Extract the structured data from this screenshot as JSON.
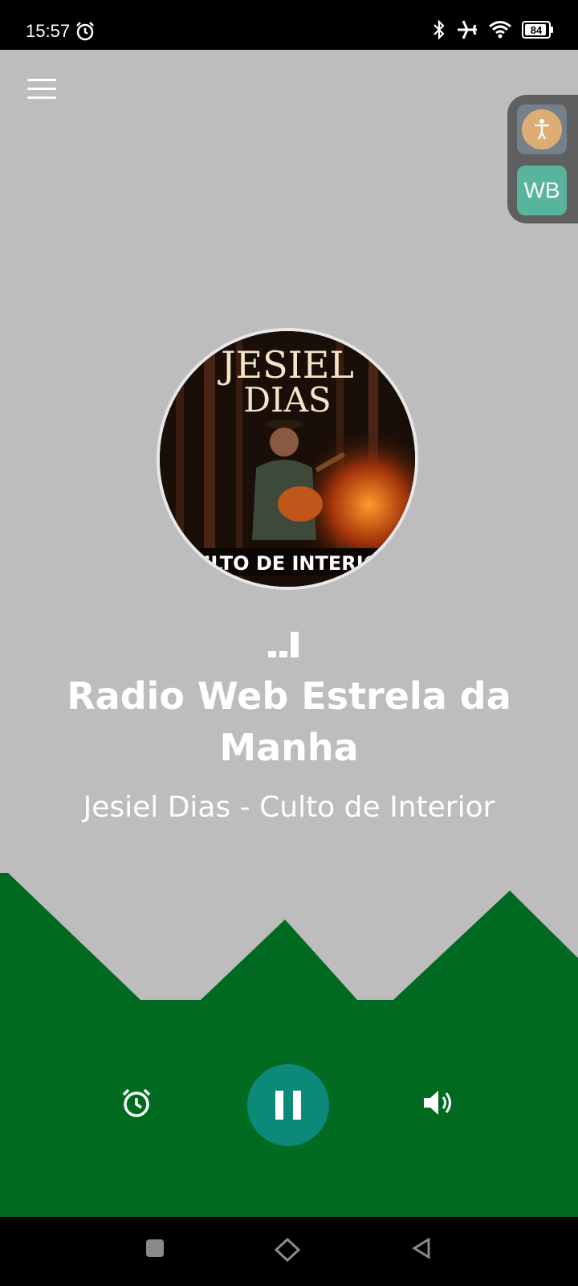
{
  "status_bar": {
    "time": "15:57",
    "battery": "84",
    "icons": [
      "alarm-icon",
      "bluetooth-icon",
      "airplane-icon",
      "wifi-icon",
      "battery-icon"
    ]
  },
  "player": {
    "station_name": "Radio Web Estrela da Manha",
    "now_playing": "Jesiel Dias - Culto de Interior",
    "cover_text_top": "JESIEL",
    "cover_text_middle": "DIAS",
    "cover_text_bottom": "ULTO DE INTERIO"
  },
  "side_widget": {
    "accessibility_icon": "accessibility-icon",
    "wb_label": "WB"
  },
  "controls": {
    "alarm_icon": "alarm-icon",
    "play_state_icon": "pause-icon",
    "volume_icon": "volume-icon"
  },
  "navbar": {
    "icons": [
      "recents-icon",
      "home-icon",
      "back-icon"
    ]
  },
  "colors": {
    "background": "#bdbdbd",
    "mountain_green": "#006b20",
    "play_button": "#0b8a7a",
    "wb_button": "#4fb49a",
    "accessibility_circle": "#e0ad6e"
  }
}
